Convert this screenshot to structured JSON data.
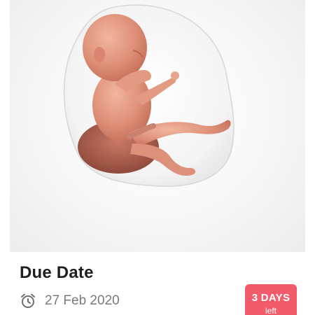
{
  "card": {
    "title": "Due Date",
    "date": "27 Feb 2020",
    "badge": {
      "count": "3 DAYS",
      "suffix": "left"
    }
  },
  "colors": {
    "badge": "#f25b6a",
    "title": "#1f1f1f",
    "date": "#7a7a7a"
  },
  "icons": {
    "date": "alarm-clock-icon",
    "hero": "fetus-illustration"
  }
}
